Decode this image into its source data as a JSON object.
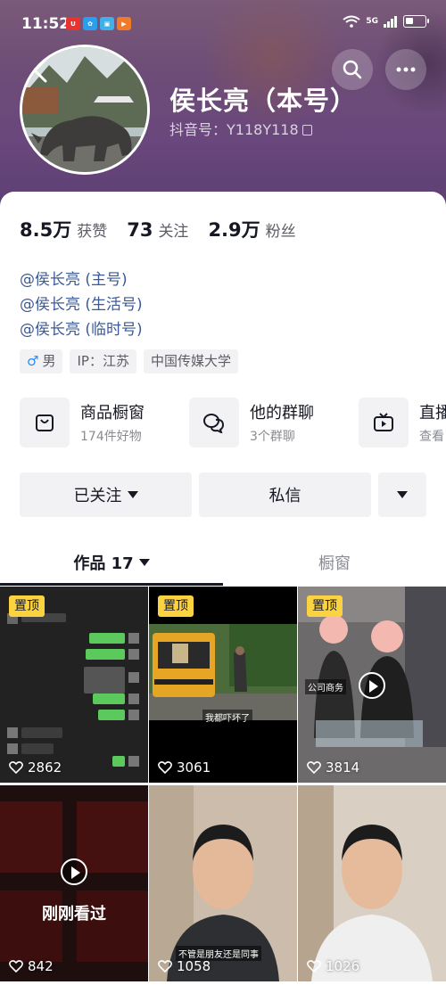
{
  "status_bar": {
    "time": "11:52",
    "network": "5G"
  },
  "profile": {
    "name": "侯长亮（本号）",
    "douyin_id": "抖音号：Y118Y118",
    "stats": [
      {
        "value": "8.5万",
        "label": "获赞"
      },
      {
        "value": "73",
        "label": "关注"
      },
      {
        "value": "2.9万",
        "label": "粉丝"
      }
    ],
    "links": [
      "@侯长亮 (主号)",
      "@侯长亮 (生活号)",
      "@侯长亮 (临时号)"
    ],
    "tags": {
      "gender_icon": "♂",
      "gender": "男",
      "ip": "IP：江苏",
      "school": "中国传媒大学"
    }
  },
  "features": [
    {
      "title": "商品橱窗",
      "sub": "174件好物",
      "icon": "bag-icon"
    },
    {
      "title": "他的群聊",
      "sub": "3个群聊",
      "icon": "chat-bubbles-icon"
    },
    {
      "title": "直播",
      "sub": "查看",
      "icon": "tv-icon"
    }
  ],
  "actions": {
    "follow": "已关注",
    "message": "私信"
  },
  "tabs": {
    "works": "作品 17",
    "window": "橱窗"
  },
  "videos": [
    {
      "pinned": "置顶",
      "likes": "2862",
      "caption": ""
    },
    {
      "pinned": "置顶",
      "likes": "3061",
      "caption": "我都吓坏了"
    },
    {
      "pinned": "置顶",
      "likes": "3814",
      "caption": "公司商务"
    },
    {
      "pinned": "",
      "likes": "842",
      "caption": "刚刚看过"
    },
    {
      "pinned": "",
      "likes": "1058",
      "caption": "不管是朋友还是同事"
    },
    {
      "pinned": "",
      "likes": "1026",
      "caption": ""
    }
  ],
  "colors": {
    "pin": "#fbd340",
    "link": "#3c5a99",
    "header": "#6a477c"
  }
}
